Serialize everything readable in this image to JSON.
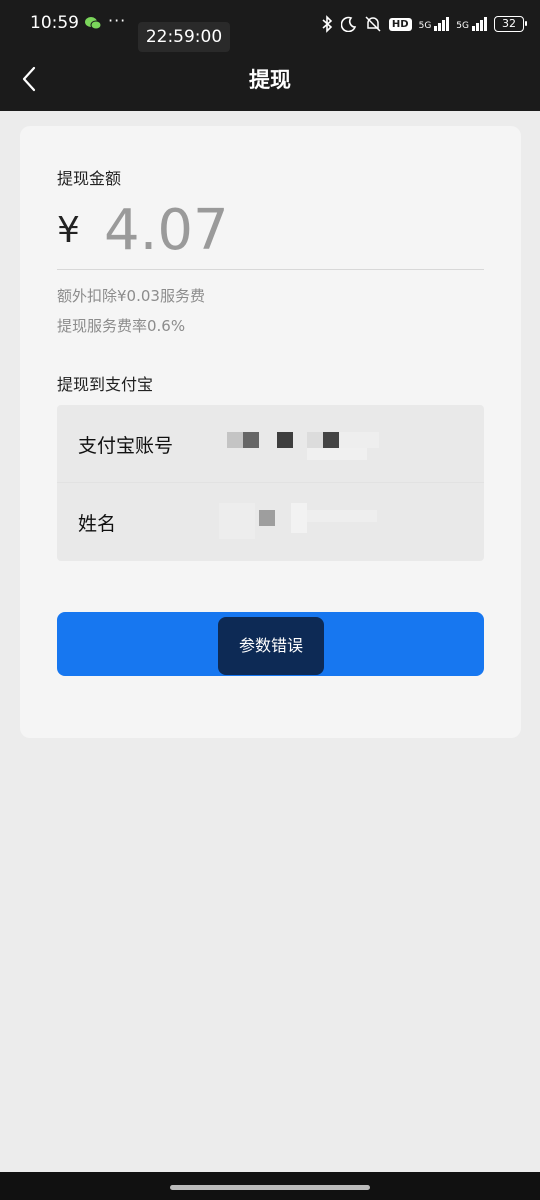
{
  "status_bar": {
    "time": "10:59",
    "more": "···",
    "clock_overlay": "22:59:00",
    "network_1": "5G",
    "network_2": "5G",
    "hd_badge": "HD",
    "battery": "32",
    "icons": [
      "wechat-icon",
      "bluetooth-icon",
      "moon-icon",
      "mute-icon",
      "hd-icon",
      "signal-5g-icon",
      "signal-5g-icon",
      "battery-icon"
    ]
  },
  "nav": {
    "title": "提现",
    "back_icon": "chevron-left-icon"
  },
  "withdraw": {
    "amount_label": "提现金额",
    "currency_symbol": "¥",
    "amount": "4.07",
    "fee_note": "额外扣除¥0.03服务费",
    "rate_note": "提现服务费率0.6%",
    "destination_label": "提现到支付宝",
    "account_label": "支付宝账号",
    "name_label": "姓名"
  },
  "toast": {
    "message": "参数错误"
  },
  "colors": {
    "primary_button": "#1777f0",
    "toast_bg": "#0d2a55",
    "topbar": "#1b1b1b"
  }
}
